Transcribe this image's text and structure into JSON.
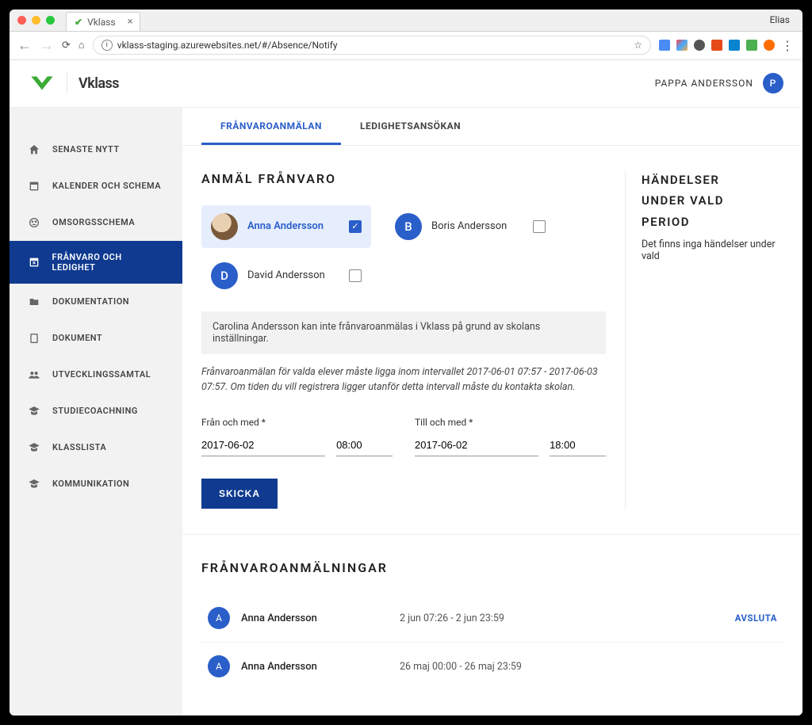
{
  "browser": {
    "tab_title": "Vklass",
    "profile": "Elias",
    "url": "vklass-staging.azurewebsites.net/#/Absence/Notify"
  },
  "header": {
    "brand": "Vklass",
    "user_name": "PAPPA ANDERSSON",
    "user_initial": "P",
    "user_color": "#2a5ec9"
  },
  "sidebar": {
    "items": [
      {
        "label": "SENASTE NYTT",
        "icon": "home"
      },
      {
        "label": "KALENDER OCH SCHEMA",
        "icon": "calendar"
      },
      {
        "label": "OMSORGSSCHEMA",
        "icon": "face"
      },
      {
        "label": "FRÅNVARO OCH LEDIGHET",
        "icon": "calendar-x",
        "active": true
      },
      {
        "label": "DOKUMENTATION",
        "icon": "folder"
      },
      {
        "label": "DOKUMENT",
        "icon": "doc"
      },
      {
        "label": "UTVECKLINGSSAMTAL",
        "icon": "people"
      },
      {
        "label": "STUDIECOACHNING",
        "icon": "grad"
      },
      {
        "label": "KLASSLISTA",
        "icon": "grad"
      },
      {
        "label": "KOMMUNIKATION",
        "icon": "grad"
      }
    ]
  },
  "tabs": [
    {
      "label": "FRÅNVAROANMÄLAN",
      "active": true
    },
    {
      "label": "LEDIGHETSANSÖKAN"
    }
  ],
  "form": {
    "title": "ANMÄL FRÅNVARO",
    "students": [
      {
        "name": "Anna Andersson",
        "initial": "A",
        "avatar": "photo",
        "checked": true
      },
      {
        "name": "Boris Andersson",
        "initial": "B",
        "avatar": "letter",
        "checked": false
      },
      {
        "name": "David Andersson",
        "initial": "D",
        "avatar": "letter",
        "checked": false
      }
    ],
    "restriction_note": "Carolina Andersson kan inte frånvaroanmälas i Vklass på grund av skolans inställningar.",
    "interval_note": "Frånvaroanmälan för valda elever måste ligga inom intervallet 2017-06-01 07:57 - 2017-06-03 07:57. Om tiden du vill registrera ligger utanför detta intervall måste du kontakta skolan.",
    "from_label": "Från och med *",
    "to_label": "Till och med *",
    "from_date": "2017-06-02",
    "from_time": "08:00",
    "to_date": "2017-06-02",
    "to_time": "18:00",
    "submit": "SKICKA"
  },
  "events": {
    "title_l1": "HÄNDELSER",
    "title_l2": "UNDER VALD",
    "title_l3": "PERIOD",
    "empty": "Det finns inga händelser under vald"
  },
  "reports": {
    "title": "FRÅNVAROANMÄLNINGAR",
    "rows": [
      {
        "initial": "A",
        "name": "Anna Andersson",
        "range": "2 jun 07:26 - 2 jun 23:59",
        "action": "AVSLUTA"
      },
      {
        "initial": "A",
        "name": "Anna Andersson",
        "range": "26 maj 00:00 - 26 maj 23:59",
        "action": ""
      }
    ]
  }
}
